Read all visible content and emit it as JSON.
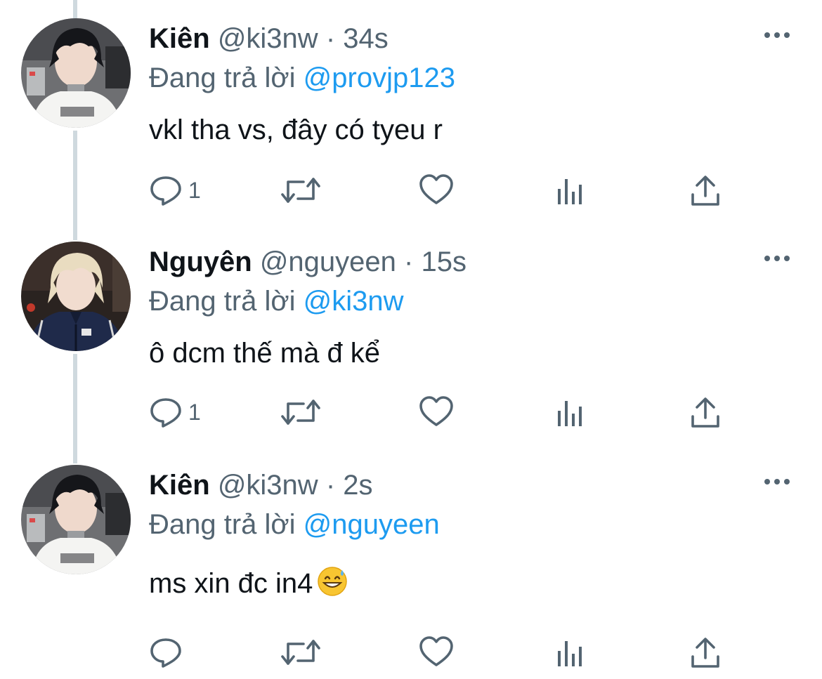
{
  "tweets": [
    {
      "name": "Kiên",
      "handle": "@ki3nw",
      "separator": "·",
      "time": "34s",
      "reply_prefix": "Đang trả lời",
      "reply_to": "@provjp123",
      "text": "vkl tha vs, đây có tyeu r",
      "reply_count": "1",
      "avatar_icon": "avatar-kien"
    },
    {
      "name": "Nguyên",
      "handle": "@nguyeen",
      "separator": "·",
      "time": "15s",
      "reply_prefix": "Đang trả lời",
      "reply_to": "@ki3nw",
      "text": "ô dcm thế mà đ kể",
      "reply_count": "1",
      "avatar_icon": "avatar-nguyen"
    },
    {
      "name": "Kiên",
      "handle": "@ki3nw",
      "separator": "·",
      "time": "2s",
      "reply_prefix": "Đang trả lời",
      "reply_to": "@nguyeen",
      "text": "ms xin đc in4",
      "emoji": "grinning-sweat-emoji",
      "reply_count": "",
      "avatar_icon": "avatar-kien"
    }
  ],
  "colors": {
    "text_primary": "#0f1419",
    "text_secondary": "#536471",
    "mention": "#1d9bf0",
    "thread_line": "#cfd9de"
  }
}
